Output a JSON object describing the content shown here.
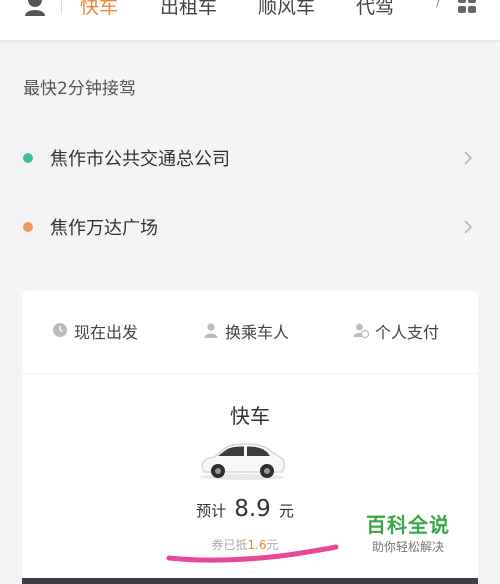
{
  "nav": {
    "tabs": [
      {
        "label": "快车",
        "active": true
      },
      {
        "label": "出租车",
        "active": false
      },
      {
        "label": "顺风车",
        "active": false
      },
      {
        "label": "代驾",
        "active": false
      }
    ],
    "slash": "/",
    "icons": [
      "person-icon",
      "grid-icon"
    ],
    "active_color": "#f0863a"
  },
  "eta": "最快2分钟接驾",
  "from": {
    "text": "焦作市公共交通总公司",
    "dot_color": "#3dbd9a"
  },
  "to": {
    "text": "焦作万达广场",
    "dot_color": "#f0975a"
  },
  "options": [
    {
      "label": "现在出发",
      "icon": "clock-icon"
    },
    {
      "label": "换乘车人",
      "icon": "person-icon"
    },
    {
      "label": "个人支付",
      "icon": "payment-icon"
    }
  ],
  "car": {
    "title": "快车",
    "price_prefix": "预计",
    "price": "8.9",
    "price_unit": "元",
    "discount_prefix": "券已抵",
    "discount_amount": "1.6",
    "discount_unit": "元"
  },
  "watermark": {
    "title": "百科全说",
    "subtitle": "助你轻松解决",
    "color": "#3aa64a"
  }
}
